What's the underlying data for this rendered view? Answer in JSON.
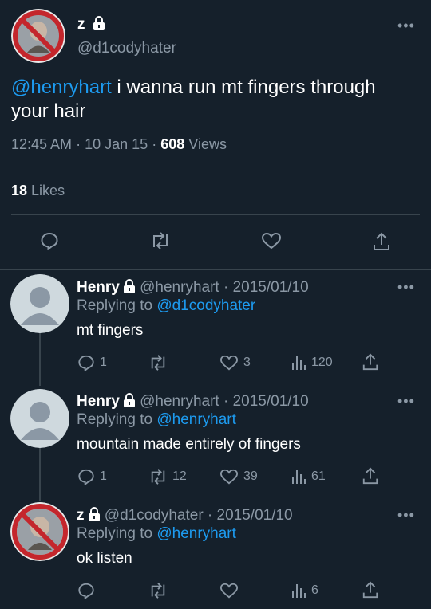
{
  "main_tweet": {
    "display_name": "z",
    "handle": "@d1codyhater",
    "mention": "@henryhart",
    "text_line1": " i wanna run mt fingers through",
    "text_line2": "your hair",
    "time": "12:45 AM",
    "sep1": "·",
    "date": "10 Jan 15",
    "sep2": "·",
    "views_count": "608",
    "views_label": "Views",
    "likes_count": "18",
    "likes_label": "Likes"
  },
  "replies": [
    {
      "display_name": "Henry",
      "handle_date": "@henryhart · 2015/01/10",
      "replying_label": "Replying to",
      "replying_to": "@d1codyhater",
      "text": "mt fingers",
      "reply_count": "1",
      "retweet_count": "",
      "like_count": "3",
      "view_count": "120"
    },
    {
      "display_name": "Henry",
      "handle_date": "@henryhart · 2015/01/10",
      "replying_label": "Replying to",
      "replying_to": "@henryhart",
      "text": "mountain made entirely of fingers",
      "reply_count": "1",
      "retweet_count": "12",
      "like_count": "39",
      "view_count": "61"
    },
    {
      "display_name": "z",
      "handle_date": "@d1codyhater · 2015/01/10",
      "replying_label": "Replying to",
      "replying_to": "@henryhart",
      "text": "ok listen",
      "reply_count": "",
      "retweet_count": "",
      "like_count": "",
      "view_count": "6"
    }
  ],
  "more_label": "•••",
  "colors": {
    "background": "#15202b",
    "accent": "#1d9bf0",
    "muted": "#8b98a5",
    "divider": "#38444d",
    "no_sign": "#c4262c"
  }
}
